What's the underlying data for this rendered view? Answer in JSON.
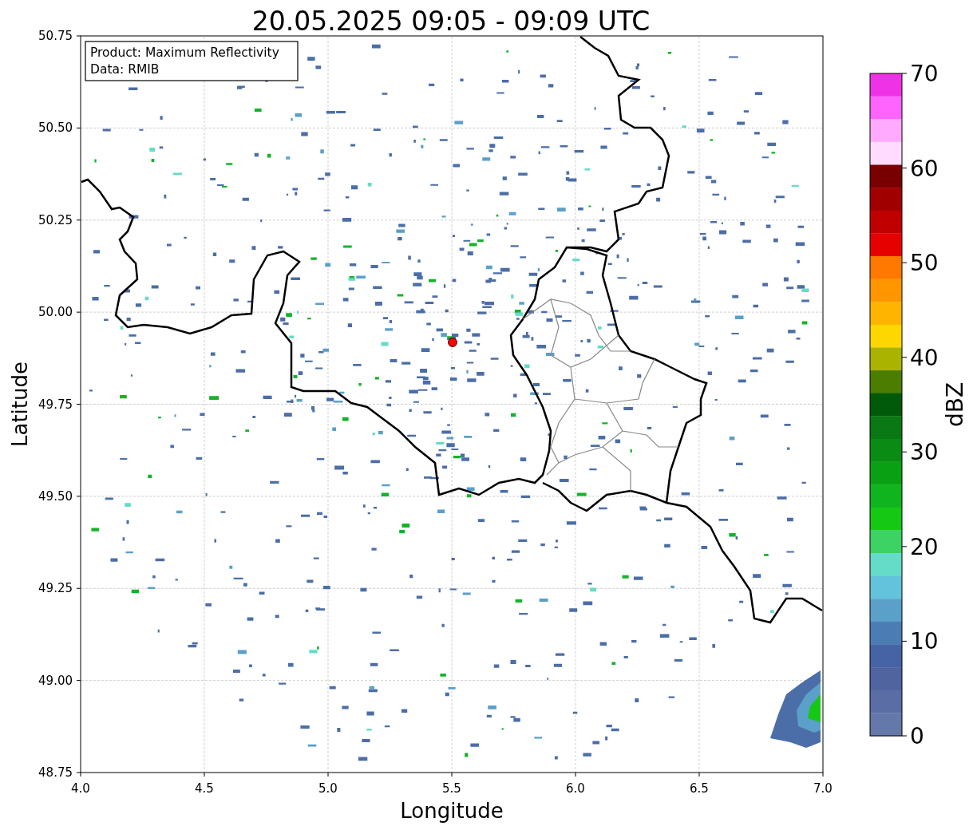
{
  "figure": {
    "title": "20.05.2025 09:05 - 09:09 UTC",
    "annotation": [
      "Product: Maximum Reflectivity",
      "Data: RMIB"
    ],
    "map_axes": {
      "xlabel": "Longitude",
      "ylabel": "Latitude",
      "grid": true,
      "xticks": [
        "4.0",
        "4.5",
        "5.0",
        "5.5",
        "6.0",
        "6.5",
        "7.0"
      ],
      "yticks": [
        "50.75",
        "50.50",
        "50.25",
        "50.00",
        "49.75",
        "49.50",
        "49.25",
        "49.00",
        "48.75"
      ]
    },
    "colorbar": {
      "label": "dBZ",
      "ticks": [
        "70",
        "60",
        "50",
        "40",
        "30",
        "20",
        "10",
        "0"
      ],
      "bands": [
        {
          "color": "#f032e6"
        },
        {
          "color": "#ff64ff"
        },
        {
          "color": "#ffaaff"
        },
        {
          "color": "#ffdcff"
        },
        {
          "color": "#780000"
        },
        {
          "color": "#a00000"
        },
        {
          "color": "#c00000"
        },
        {
          "color": "#e60000"
        },
        {
          "color": "#ff7800"
        },
        {
          "color": "#ff9600"
        },
        {
          "color": "#ffb400"
        },
        {
          "color": "#ffd700"
        },
        {
          "color": "#aab400"
        },
        {
          "color": "#4b7d00"
        },
        {
          "color": "#005a0a"
        },
        {
          "color": "#0a7814"
        },
        {
          "color": "#0a8c14"
        },
        {
          "color": "#0aa014"
        },
        {
          "color": "#10b41e"
        },
        {
          "color": "#14c814"
        },
        {
          "color": "#3cd264"
        },
        {
          "color": "#64dcc8"
        },
        {
          "color": "#64c3dc"
        },
        {
          "color": "#5aa0c8"
        },
        {
          "color": "#4b7db4"
        },
        {
          "color": "#4664a5"
        },
        {
          "color": "#5064a0"
        },
        {
          "color": "#5a6ea5"
        },
        {
          "color": "#6478aa"
        }
      ]
    }
  }
}
